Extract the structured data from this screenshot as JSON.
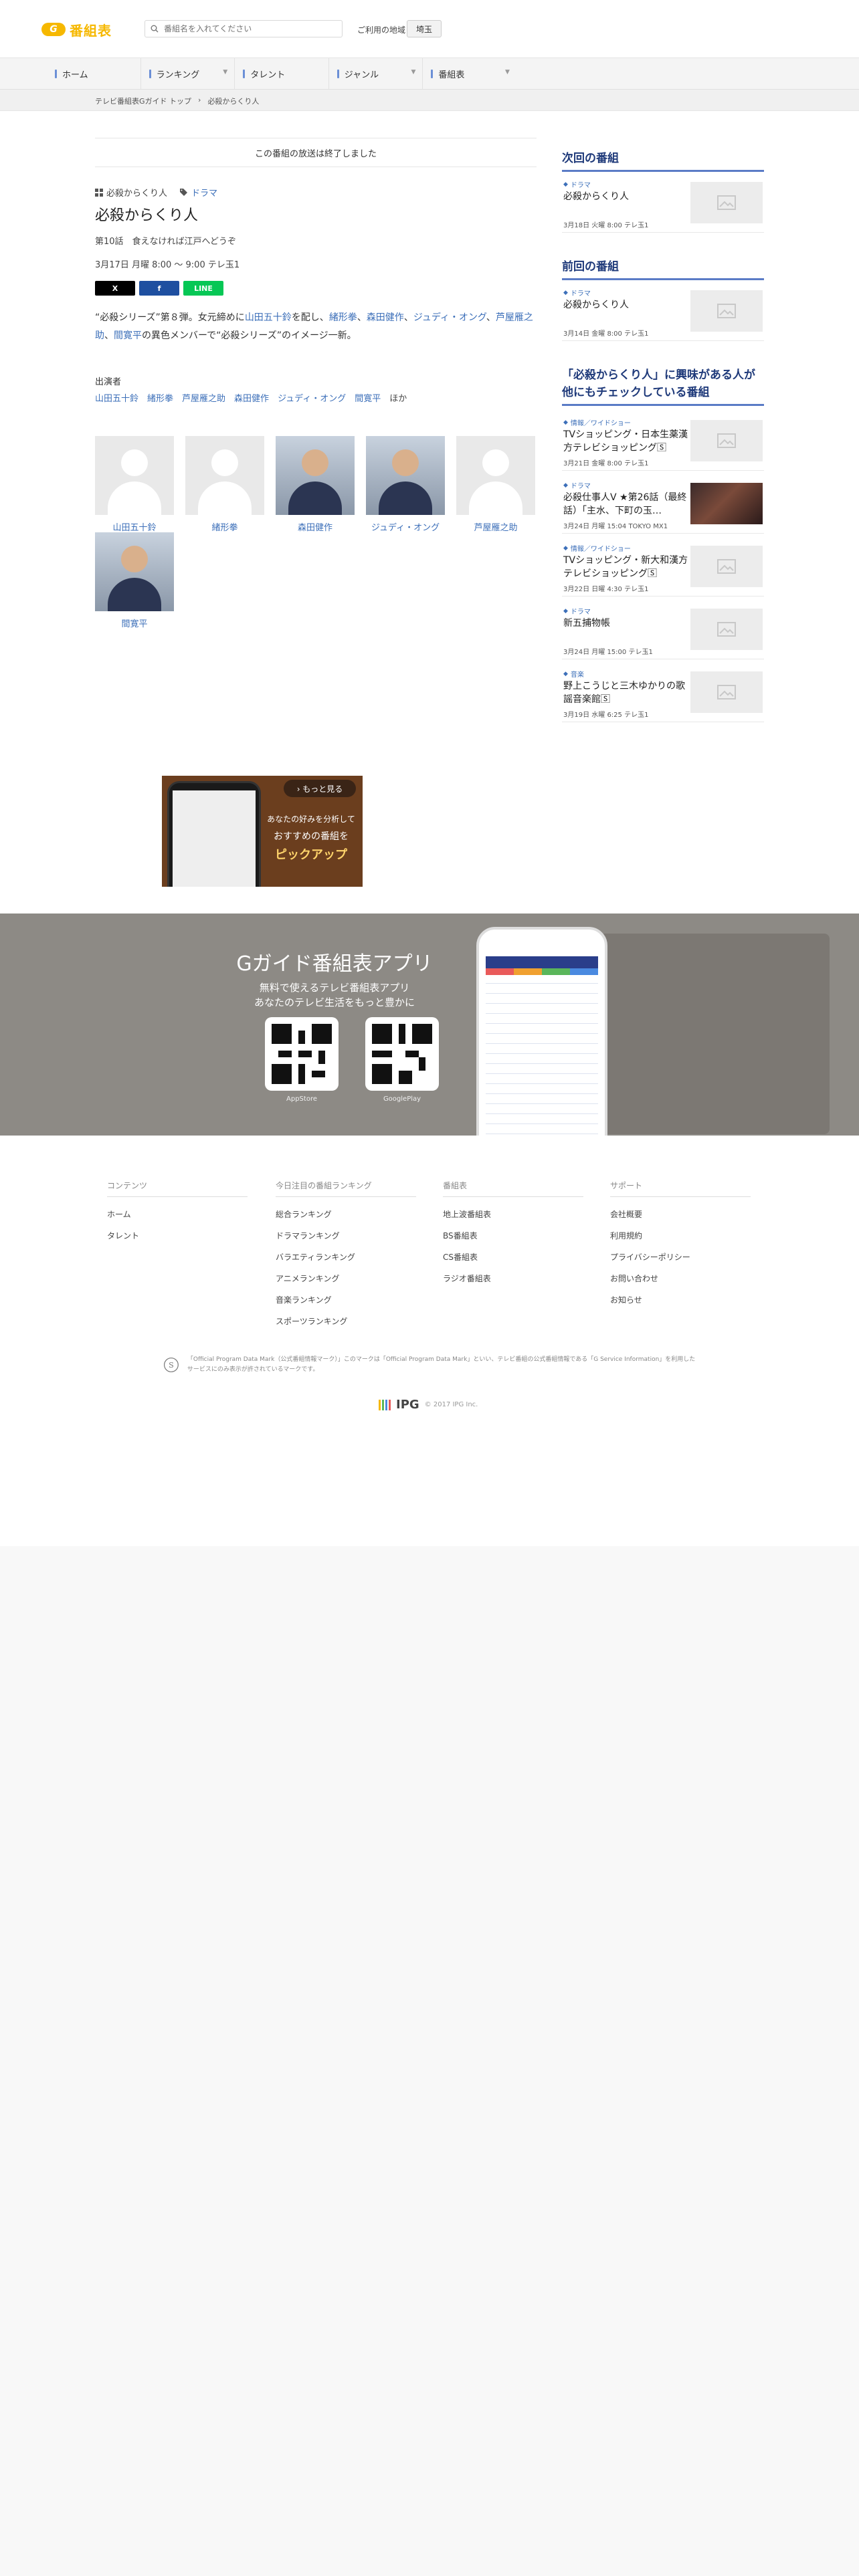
{
  "header": {
    "logo_badge": "G",
    "logo_text": "番組表",
    "search_placeholder": "番組名を入れてください",
    "region_label": "ご利用の地域",
    "region_value": "埼玉"
  },
  "nav": {
    "items": [
      {
        "label": "ホーム",
        "caret": false
      },
      {
        "label": "ランキング",
        "caret": true
      },
      {
        "label": "タレント",
        "caret": false
      },
      {
        "label": "ジャンル",
        "caret": true
      },
      {
        "label": "番組表",
        "caret": true
      }
    ]
  },
  "breadcrumb": [
    "テレビ番組表Gガイド トップ",
    "›",
    "必殺からくり人"
  ],
  "program": {
    "ended_notice": "この番組の放送は終了しました",
    "series_tag": "必殺からくり人",
    "genre_tag": "ドラマ",
    "title": "必殺からくり人",
    "episode": "第10話　食えなければ江戸へどうぞ",
    "airtime": "3月17日 月曜 8:00 ～ 9:00 テレ玉1",
    "share": {
      "x": "X",
      "facebook": "f",
      "line": "LINE"
    },
    "description": [
      {
        "t": "“必殺シリーズ”第８弾。女元締めに",
        "link": false
      },
      {
        "t": "山田五十鈴",
        "link": true
      },
      {
        "t": "を配し、",
        "link": false
      },
      {
        "t": "緒形拳",
        "link": true
      },
      {
        "t": "、",
        "link": false
      },
      {
        "t": "森田健作",
        "link": true
      },
      {
        "t": "、",
        "link": false
      },
      {
        "t": "ジュディ・オング",
        "link": true
      },
      {
        "t": "、",
        "link": false
      },
      {
        "t": "芦屋雁之助",
        "link": true
      },
      {
        "t": "、",
        "link": false
      },
      {
        "t": "間寛平",
        "link": true
      },
      {
        "t": "の異色メンバーで“必殺シリーズ”のイメージ一新。",
        "link": false
      }
    ],
    "cast_heading": "出演者",
    "cast_names": [
      "山田五十鈴",
      "緒形拳",
      "芦屋雁之助",
      "森田健作",
      "ジュディ・オング",
      "間寛平"
    ],
    "cast_others": "ほか",
    "cast_cards": [
      {
        "name": "山田五十鈴",
        "photo": "placeholder"
      },
      {
        "name": "緒形拳",
        "photo": "placeholder"
      },
      {
        "name": "森田健作",
        "photo": "portrait"
      },
      {
        "name": "ジュディ・オング",
        "photo": "portrait"
      },
      {
        "name": "芦屋雁之助",
        "photo": "placeholder"
      },
      {
        "name": "間寛平",
        "photo": "portrait"
      }
    ]
  },
  "sidebar": {
    "next_heading": "次回の番組",
    "next": {
      "genre": "ドラマ",
      "title": "必殺からくり人",
      "date": "3月18日 火曜 8:00 テレ玉1"
    },
    "prev_heading": "前回の番組",
    "prev": {
      "genre": "ドラマ",
      "title": "必殺からくり人",
      "date": "3月14日 金曜 8:00 テレ玉1"
    },
    "related_heading": "「必殺からくり人」に興味がある人が他にもチェックしている番組",
    "related": [
      {
        "genre": "情報／ワイドショー",
        "title": "TVショッピング・日本生薬漢方テレビショッピング🅂",
        "date": "3月21日 金曜 8:00 テレ玉1",
        "thumb": "placeholder"
      },
      {
        "genre": "ドラマ",
        "title": "必殺仕事人Ⅴ ★第26話（最終話）「主水、下町の玉…",
        "date": "3月24日 月曜 15:04 TOKYO MX1",
        "thumb": "image"
      },
      {
        "genre": "情報／ワイドショー",
        "title": "TVショッピング・新大和漢方テレビショッピング🅂",
        "date": "3月22日 日曜 4:30 テレ玉1",
        "thumb": "placeholder"
      },
      {
        "genre": "ドラマ",
        "title": "新五捕物帳",
        "date": "3月24日 月曜 15:00 テレ玉1",
        "thumb": "placeholder"
      },
      {
        "genre": "音楽",
        "title": "野上こうじと三木ゆかりの歌謡音楽館🅂",
        "date": "3月19日 水曜 6:25 テレ玉1",
        "thumb": "placeholder"
      }
    ]
  },
  "ad": {
    "more": "› もっと見る",
    "line1": "あなたの好みを分析して",
    "line2": "おすすめの番組を",
    "line3": "ピックアップ"
  },
  "app_band": {
    "title": "Gガイド番組表アプリ",
    "sub1": "無料で使えるテレビ番組表アプリ",
    "sub2": "あなたのテレビ生活をもっと豊かに",
    "appstore": "AppStore",
    "googleplay": "GooglePlay"
  },
  "footer": {
    "columns": [
      {
        "heading": "コンテンツ",
        "links": [
          "ホーム",
          "タレント"
        ]
      },
      {
        "heading": "今日注目の番組ランキング",
        "links": [
          "総合ランキング",
          "ドラマランキング",
          "バラエティランキング",
          "アニメランキング",
          "音楽ランキング",
          "スポーツランキング"
        ]
      },
      {
        "heading": "番組表",
        "links": [
          "地上波番組表",
          "BS番組表",
          "CS番組表",
          "ラジオ番組表"
        ]
      },
      {
        "heading": "サポート",
        "links": [
          "会社概要",
          "利用規約",
          "プライバシーポリシー",
          "お問い合わせ",
          "お知らせ"
        ]
      }
    ],
    "notice": "「Official Program Data Mark（公式番組情報マーク）」このマークは「Official Program Data Mark」といい、テレビ番組の公式番組情報である「G Service Information」を利用したサービスにのみ表示が許されているマークです。",
    "ipg_logo": "IPG",
    "copyright": "© 2017 IPG Inc."
  },
  "colors": {
    "accent": "#f6b800",
    "link": "#3c6fb9",
    "heading_blue": "#1f3a7a",
    "line_green": "#06c755",
    "facebook": "#1877f2"
  }
}
